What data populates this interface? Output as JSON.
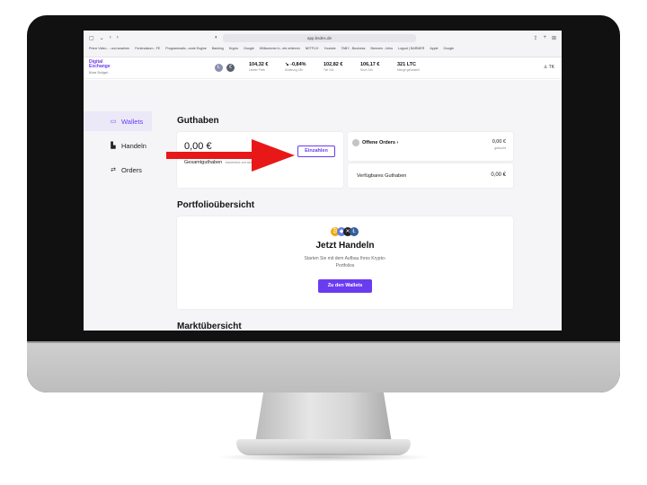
{
  "browser": {
    "address": "app.bsdex.de",
    "bookmarks": [
      "Prime Video ... und ansehen",
      "Feriendatum - FE",
      "Programmatic...onde Engine",
      "Banking",
      "Krypto",
      "Google",
      "Willkommen b...ete erfahren",
      "NETFLIX",
      "Youtube",
      "TABY - Business",
      "Brennen - Infos",
      "Logout | BARMER",
      "Apple",
      "Google"
    ]
  },
  "app": {
    "logo_line1": "Digital",
    "logo_line2": "Exchange",
    "logo_sub": "Börse Stuttgart",
    "coins": [
      {
        "symbol": "Ł",
        "color": "#8a8fb0"
      },
      {
        "symbol": "€",
        "color": "#5a6070"
      }
    ],
    "tickers": [
      {
        "value": "104,32 €",
        "label": "Letzter Preis"
      },
      {
        "value": "↘ -0,84%",
        "label": "Änderung 24h"
      },
      {
        "value": "102,82 €",
        "label": "Tief 24h"
      },
      {
        "value": "106,17 €",
        "label": "Hoch 24h"
      },
      {
        "value": "321 LTC",
        "label": "Menge gehandelt"
      }
    ],
    "user_initials": "TK"
  },
  "sidebar": {
    "items": [
      {
        "label": "Wallets",
        "icon": "wallet-icon",
        "active": true
      },
      {
        "label": "Handeln",
        "icon": "chart-icon",
        "active": false
      },
      {
        "label": "Orders",
        "icon": "swap-icon",
        "active": false
      }
    ]
  },
  "guthaben": {
    "title": "Guthaben",
    "amount": "0,00 €",
    "total_label": "Gesamtguthaben",
    "total_hint": "basierend auf aktuellen Kursen",
    "deposit_button": "Einzahlen",
    "open_orders_label": "Offene Orders",
    "open_orders_value": "0,00 €",
    "open_orders_sub": "gebucht",
    "available_label": "Verfügbares Guthaben",
    "available_value": "0,00 €"
  },
  "portfolio": {
    "title": "Portfolioübersicht",
    "headline": "Jetzt Handeln",
    "text_line1": "Starten Sie mit dem Aufbau Ihres Krypto-",
    "text_line2": "Portfolios",
    "button": "Zu den Wallets"
  },
  "market": {
    "title": "Marktübersicht"
  },
  "colors": {
    "accent": "#6a3cf0",
    "arrow": "#e81818"
  }
}
